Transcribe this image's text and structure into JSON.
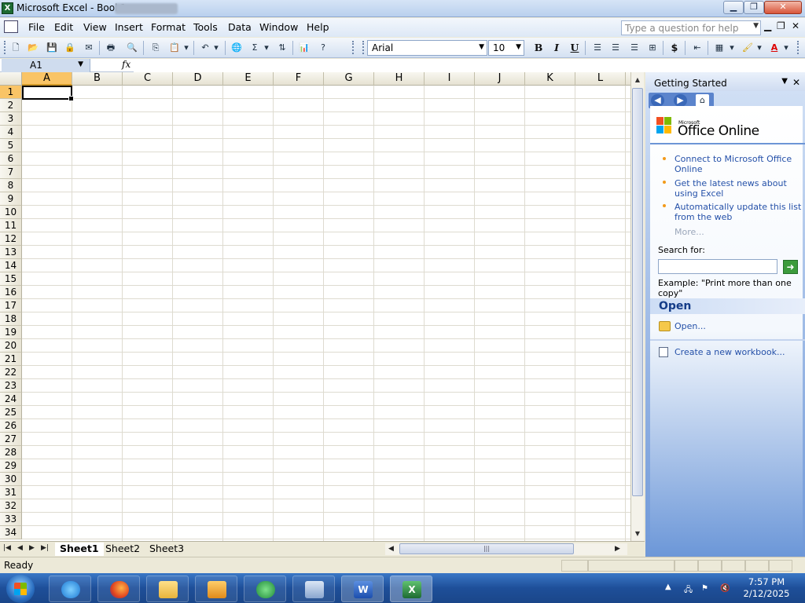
{
  "window": {
    "title": "Microsoft Excel - Book1",
    "app_icon": "excel-icon",
    "controls": [
      "minimize",
      "restore",
      "close"
    ]
  },
  "menubar": {
    "items": [
      "File",
      "Edit",
      "View",
      "Insert",
      "Format",
      "Tools",
      "Data",
      "Window",
      "Help"
    ],
    "help_placeholder": "Type a question for help"
  },
  "toolbar": {
    "font": "Arial",
    "size": "10",
    "bold": "B",
    "italic": "I",
    "underline": "U",
    "currency": "$"
  },
  "formula_bar": {
    "name_box": "A1",
    "fx": "fx",
    "formula": ""
  },
  "sheet": {
    "columns": [
      "A",
      "B",
      "C",
      "D",
      "E",
      "F",
      "G",
      "H",
      "I",
      "J",
      "K",
      "L"
    ],
    "rows": [
      "1",
      "2",
      "3",
      "4",
      "5",
      "6",
      "7",
      "8",
      "9",
      "10",
      "11",
      "12",
      "13",
      "14",
      "15",
      "16",
      "17",
      "18",
      "19",
      "20",
      "21",
      "22",
      "23",
      "24",
      "25",
      "26",
      "27",
      "28",
      "29",
      "30",
      "31",
      "32",
      "33",
      "34"
    ],
    "active_cell": "A1",
    "tabs": [
      "Sheet1",
      "Sheet2",
      "Sheet3"
    ],
    "active_tab": "Sheet1"
  },
  "taskpane": {
    "title": "Getting Started",
    "logo_small": "Microsoft",
    "logo_big": "Office Online",
    "links": [
      "Connect to Microsoft Office Online",
      "Get the latest news about using Excel",
      "Automatically update this list from the web"
    ],
    "more": "More...",
    "search_label": "Search for:",
    "example": "Example:  \"Print more than one copy\"",
    "open_section": "Open",
    "open_link": "Open...",
    "new_workbook": "Create a new workbook..."
  },
  "status": {
    "text": "Ready"
  },
  "taskbar": {
    "time": "7:57 PM",
    "date": "2/12/2025",
    "apps": [
      "internet-explorer",
      "firefox",
      "file-explorer",
      "media-player",
      "messenger",
      "control-panel",
      "word",
      "excel"
    ]
  },
  "colors": {
    "accent": "#2450a8",
    "selected_header": "#f9c466",
    "taskbar": "#1e4f99"
  }
}
